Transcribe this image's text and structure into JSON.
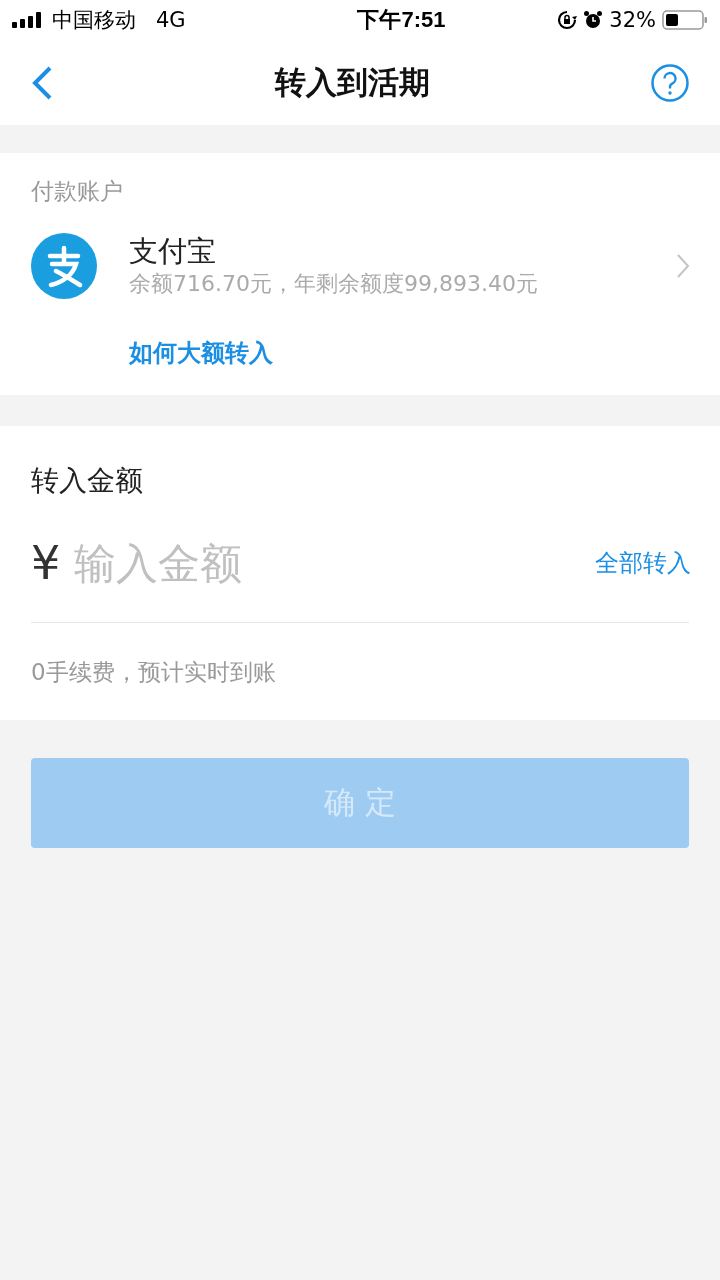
{
  "status_bar": {
    "carrier": "中国移动",
    "network": "4G",
    "time": "下午7:51",
    "battery": "32%"
  },
  "nav": {
    "title": "转入到活期"
  },
  "payment_account": {
    "label": "付款账户",
    "name": "支付宝",
    "detail": "余额716.70元，年剩余额度99,893.40元",
    "link": "如何大额转入"
  },
  "amount": {
    "label": "转入金额",
    "currency": "¥",
    "placeholder": "输入金额",
    "all_button": "全部转入",
    "note": "0手续费，预计实时到账"
  },
  "confirm": {
    "label": "确 定",
    "disabled": true
  }
}
